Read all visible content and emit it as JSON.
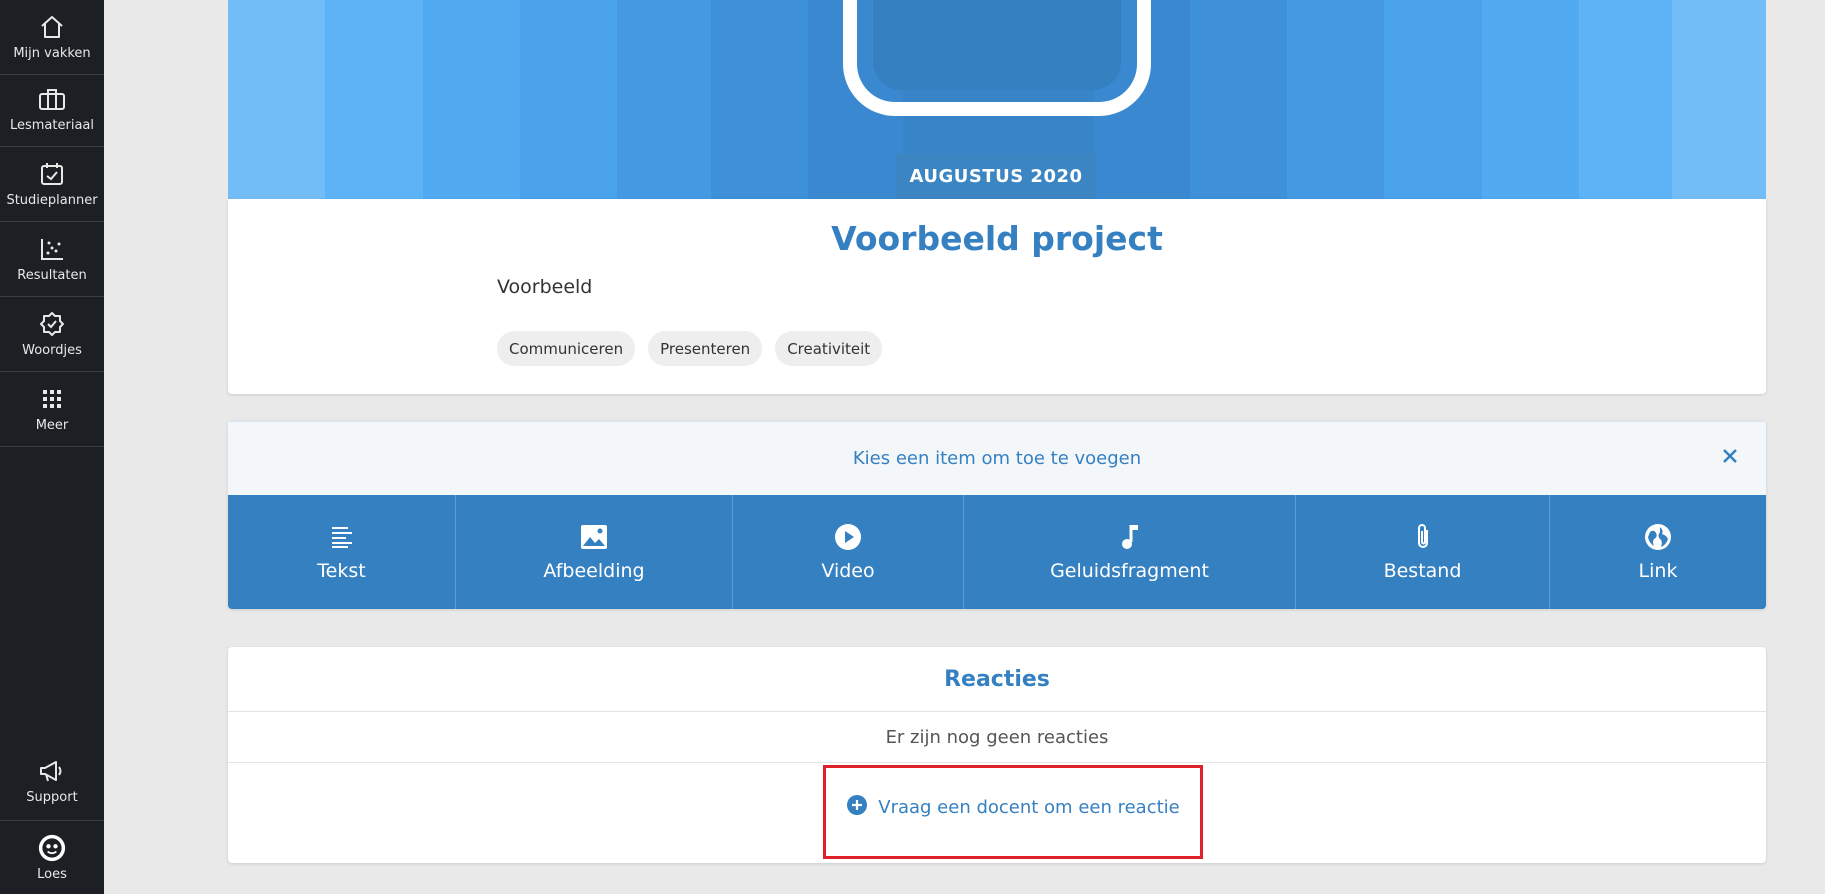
{
  "sidebar": {
    "items": [
      {
        "label": "Mijn vakken",
        "icon": "home-icon"
      },
      {
        "label": "Lesmateriaal",
        "icon": "briefcase-icon"
      },
      {
        "label": "Studieplanner",
        "icon": "calendar-check-icon"
      },
      {
        "label": "Resultaten",
        "icon": "scatter-chart-icon"
      },
      {
        "label": "Woordjes",
        "icon": "badge-check-icon"
      },
      {
        "label": "Meer",
        "icon": "grid-icon"
      }
    ],
    "support_label": "Support",
    "user_label": "Loes"
  },
  "project": {
    "date_badge": "AUGUSTUS 2020",
    "title": "Voorbeeld project",
    "description": "Voorbeeld",
    "tags": [
      "Communiceren",
      "Presenteren",
      "Creativiteit"
    ]
  },
  "add_panel": {
    "title": "Kies een item om toe te voegen",
    "items": [
      {
        "label": "Tekst",
        "icon": "text-lines-icon"
      },
      {
        "label": "Afbeelding",
        "icon": "image-icon"
      },
      {
        "label": "Video",
        "icon": "play-circle-icon"
      },
      {
        "label": "Geluidsfragment",
        "icon": "music-note-icon"
      },
      {
        "label": "Bestand",
        "icon": "paperclip-icon"
      },
      {
        "label": "Link",
        "icon": "globe-icon"
      }
    ]
  },
  "reacties": {
    "title": "Reacties",
    "empty_text": "Er zijn nog geen reacties",
    "ask_label": "Vraag een docent om een reactie"
  },
  "colors": {
    "accent": "#3580c1",
    "sidebar_bg": "#1c1f23",
    "highlight": "#e0202a"
  }
}
